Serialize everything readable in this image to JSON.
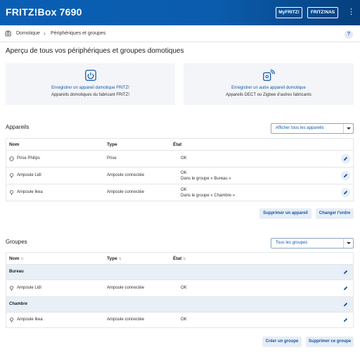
{
  "header": {
    "brand": "FRITZ!Box 7690",
    "myfritz_label": "MyFRITZ!",
    "fritznas_label": "FRITZ!NAS",
    "menu_icon": "kebab-menu-icon"
  },
  "breadcrumb": {
    "items": [
      "Domotique",
      "Périphériques et groupes"
    ],
    "help": "?"
  },
  "page_title": "Aperçu de tous vos périphériques et groupes domotiques",
  "cards": [
    {
      "title": "Enregistrer un appareil domotique FRITZ!",
      "subtitle": "Appareils domotiques du fabricant FRITZ!",
      "icon": "power-device-icon"
    },
    {
      "title": "Enregistrer un autre appareil domotique",
      "subtitle": "Appareils DECT ou Zigbee d'autres fabricants",
      "icon": "wireless-device-icon"
    }
  ],
  "devices": {
    "title": "Appareils",
    "filter_value": "Afficher tous les appareils",
    "columns": [
      "Nom",
      "Type",
      "État"
    ],
    "rows": [
      {
        "name": "Prise Philips",
        "type": "Prise",
        "state": [
          "OK"
        ],
        "icon": "plug-icon"
      },
      {
        "name": "Ampoule Lidl",
        "type": "Ampoule connectée",
        "state": [
          "OK",
          "Dans le groupe « Bureau »"
        ],
        "icon": "bulb-icon"
      },
      {
        "name": "Ampoule Ikea",
        "type": "Ampoule connectée",
        "state": [
          "OK",
          "Dans le groupe « Chambre »"
        ],
        "icon": "bulb-icon"
      }
    ],
    "buttons": {
      "delete": "Supprimer un appareil",
      "reorder": "Changer l'ordre"
    }
  },
  "groups": {
    "title": "Groupes",
    "filter_value": "Tous les groupes",
    "columns": [
      "Nom",
      "Type",
      "État"
    ],
    "rows": [
      {
        "group": "Bureau"
      },
      {
        "name": "Ampoule Lidl",
        "type": "Ampoule connectée",
        "state": "OK"
      },
      {
        "group": "Chambre"
      },
      {
        "name": "Ampoule Ikea",
        "type": "Ampoule connectée",
        "state": "OK"
      }
    ],
    "buttons": {
      "create": "Créer un groupe",
      "delete": "Supprimer ce groupe"
    }
  },
  "colors": {
    "header": "#0a5fb4",
    "link": "#1558a8",
    "button_bg": "#e6edf5",
    "group_row": "#e8eff7"
  }
}
